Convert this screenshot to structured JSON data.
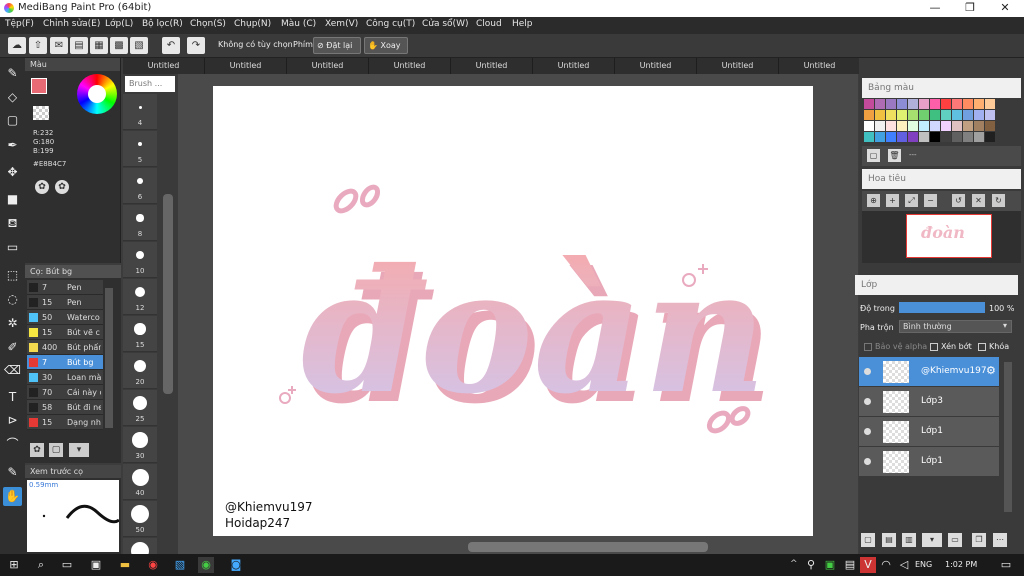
{
  "window": {
    "title": "MediBang Paint Pro (64bit)",
    "minimize": "—",
    "maximize": "❐",
    "close": "✕"
  },
  "menu": [
    "Tệp(F)",
    "Chỉnh sửa(E)",
    "Lớp(L)",
    "Bộ lọc(R)",
    "Chọn(S)",
    "Chụp(N)",
    "Màu (C)",
    "Xem(V)",
    "Công cụ(T)",
    "Cửa sổ(W)",
    "Cloud",
    "Help"
  ],
  "toolbar": {
    "no_selection": "Không có tùy chọn",
    "key_label": "Phím",
    "reset": "Đặt lại",
    "rotate": "Xoay"
  },
  "tabs": [
    "Untitled",
    "Untitled",
    "Untitled",
    "Untitled",
    "Untitled",
    "Untitled",
    "Untitled",
    "Untitled",
    "Untitled",
    "Untitled"
  ],
  "color_panel": {
    "title": "Màu",
    "r": "R:232",
    "g": "G:180",
    "b": "B:199",
    "hex": "#E8B4C7",
    "primary_color": "#e86a74",
    "secondary_color": "#ffffff"
  },
  "brush_panel": {
    "title": "Cọ: Bút bg",
    "items": [
      {
        "size": "7",
        "name": "Pen",
        "color": "#222222"
      },
      {
        "size": "15",
        "name": "Pen",
        "color": "#222222"
      },
      {
        "size": "50",
        "name": "Waterco",
        "color": "#4fc3f7"
      },
      {
        "size": "15",
        "name": "Bút vẽ c",
        "color": "#f5e642"
      },
      {
        "size": "400",
        "name": "Bút phấn",
        "color": "#f2d94e"
      },
      {
        "size": "7",
        "name": "Bút bg",
        "color": "#e53935"
      },
      {
        "size": "30",
        "name": "Loan mà",
        "color": "#4fc3f7"
      },
      {
        "size": "70",
        "name": "Cái này c",
        "color": "#222222"
      },
      {
        "size": "58",
        "name": "Bút đi ne",
        "color": "#222222"
      },
      {
        "size": "15",
        "name": "Dạng nh",
        "color": "#e53935"
      }
    ]
  },
  "preview_panel": {
    "title": "Xem trước cọ",
    "size": "0.59mm"
  },
  "brush_sizes": [
    "4",
    "5",
    "6",
    "8",
    "10",
    "12",
    "15",
    "20",
    "25",
    "30",
    "40",
    "50",
    "70"
  ],
  "size_panel_label": "Brush ...",
  "canvas": {
    "main_text": "đoàn",
    "credit_1": "@Khiemvu197",
    "credit_2": "Hoidap247"
  },
  "palette_panel": {
    "title": "Bảng màu",
    "footer": "---",
    "colors": [
      "#c44b9b",
      "#b06bb5",
      "#9a78c2",
      "#8d8dd6",
      "#b0b0d8",
      "#e8a0c8",
      "#ff5ea8",
      "#ff4040",
      "#ff7878",
      "#ff8c60",
      "#ffb070",
      "#ffcc99",
      "#f0a040",
      "#f0c040",
      "#f0e060",
      "#e0f070",
      "#a8e070",
      "#70d070",
      "#40c080",
      "#60d0c0",
      "#60c0e0",
      "#70a0e0",
      "#a0b0f0",
      "#c0c0f0",
      "#ffffff",
      "#f0f0f0",
      "#ffe0e0",
      "#fff0c0",
      "#e0ffe0",
      "#c0f0ff",
      "#d0d8ff",
      "#f0d0ff",
      "#e0c0c0",
      "#c0a080",
      "#a08060",
      "#806040",
      "#40c0c0",
      "#40a0e0",
      "#4080ff",
      "#6060e0",
      "#8040c0",
      "#c0c0c0",
      "#000000",
      "#404040",
      "#606060",
      "#808080",
      "#a0a0a0",
      "#202020"
    ]
  },
  "navigator_panel": {
    "title": "Hoa tiêu"
  },
  "layer_panel": {
    "title": "Lớp",
    "opacity_label": "Độ trong",
    "opacity_value": "100 %",
    "opacity_fraction": 1.0,
    "blend_label": "Pha trộn",
    "blend_value": "Bình thường",
    "protect_alpha": "Bảo vệ alpha",
    "clipping": "Xén bớt",
    "lock": "Khóa",
    "layers": [
      {
        "name": "@Khiemvu197",
        "selected": true
      },
      {
        "name": "Lớp3",
        "selected": false
      },
      {
        "name": "Lớp1",
        "selected": false
      },
      {
        "name": "Lớp1",
        "selected": false
      }
    ]
  },
  "taskbar": {
    "lang": "ENG",
    "time": "1:02 PM"
  }
}
